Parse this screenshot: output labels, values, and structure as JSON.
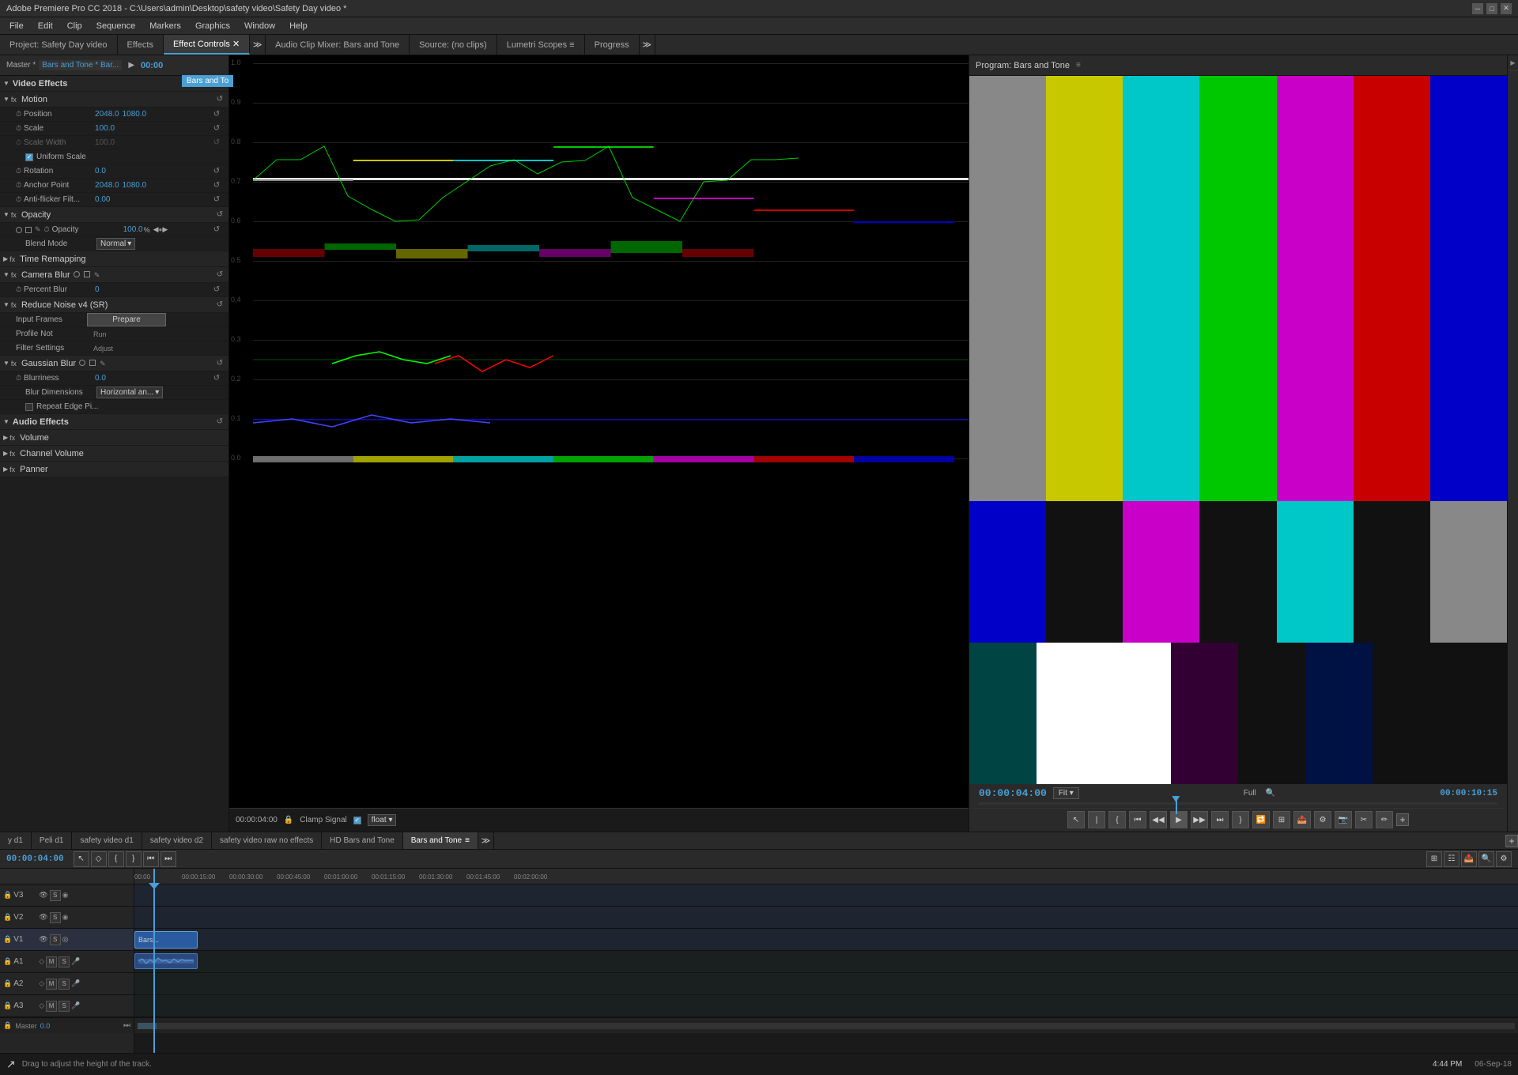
{
  "window": {
    "title": "Adobe Premiere Pro CC 2018 - C:\\Users\\admin\\Desktop\\safety video\\Safety Day video *"
  },
  "menu": {
    "items": [
      "File",
      "Edit",
      "Clip",
      "Sequence",
      "Markers",
      "Graphics",
      "Window",
      "Help"
    ]
  },
  "tabs": {
    "items": [
      {
        "label": "Project: Safety Day video",
        "active": false
      },
      {
        "label": "Effects",
        "active": false
      },
      {
        "label": "Effect Controls",
        "active": true
      },
      {
        "label": "Audio Clip Mixer: Bars and Tone",
        "active": false
      },
      {
        "label": "Source: (no clips)",
        "active": false
      },
      {
        "label": "Lumetri Scopes",
        "active": false
      },
      {
        "label": "Progress",
        "active": false
      }
    ]
  },
  "effect_controls": {
    "master_label": "Master * Bars and Tone *",
    "clip_name": "Bars and Tone * Bar...",
    "time": "00:00",
    "tooltip": "Bars and To",
    "video_effects_label": "Video Effects",
    "motion": {
      "label": "Motion",
      "position_label": "Position",
      "position_x": "2048.0",
      "position_y": "1080.0",
      "scale_label": "Scale",
      "scale_value": "100.0",
      "scale_width_label": "Scale Width",
      "scale_width_value": "100.0",
      "rotation_label": "Rotation",
      "rotation_value": "0.0",
      "anchor_point_label": "Anchor Point",
      "anchor_x": "2048.0",
      "anchor_y": "1080.0",
      "anti_flicker_label": "Anti-flicker Filt...",
      "anti_flicker_value": "0.00",
      "uniform_scale_label": "Uniform Scale"
    },
    "opacity": {
      "label": "Opacity",
      "opacity_label": "Opacity",
      "opacity_value": "100.0",
      "opacity_unit": "%",
      "blend_mode_label": "Blend Mode",
      "blend_mode_value": "Normal"
    },
    "time_remapping": {
      "label": "Time Remapping"
    },
    "camera_blur": {
      "label": "Camera Blur",
      "percent_blur_label": "Percent Blur",
      "percent_blur_value": "0"
    },
    "reduce_noise": {
      "label": "Reduce Noise v4 (SR)",
      "input_frames_label": "Input Frames",
      "prepare_btn": "Prepare",
      "profile_not_label": "Profile Not",
      "profile_run_label": "Run",
      "filter_settings_label": "Filter Settings",
      "adjust_label": "Adjust"
    },
    "gaussian_blur": {
      "label": "Gaussian Blur",
      "blurriness_label": "Blurriness",
      "blurriness_value": "0.0",
      "blur_dimensions_label": "Blur Dimensions",
      "blur_dimensions_value": "Horizontal an...",
      "repeat_edge_label": "Repeat Edge Pi..."
    },
    "audio_effects_label": "Audio Effects",
    "volume": {
      "label": "Volume"
    },
    "channel_volume": {
      "label": "Channel Volume"
    },
    "panner": {
      "label": "Panner"
    }
  },
  "scope": {
    "labels": [
      "1.0",
      "0.9",
      "0.8",
      "0.7",
      "0.6",
      "0.5",
      "0.4",
      "0.3",
      "0.2",
      "0.1",
      "0.0"
    ],
    "y_positions": [
      0,
      50,
      100,
      150,
      200,
      250,
      300,
      350,
      400,
      450,
      500
    ],
    "clamp_signal_label": "Clamp Signal",
    "float_label": "float",
    "time": "00:00:04:00"
  },
  "program_monitor": {
    "title": "Program: Bars and Tone",
    "timecode": "00:00:04:00",
    "fit_label": "Fit",
    "full_label": "Full",
    "duration": "00:00:10:15",
    "color_bars": {
      "top_colors": [
        "#888888",
        "#c8c800",
        "#00c8c8",
        "#00c800",
        "#c800c8",
        "#c80000",
        "#0000c8"
      ],
      "bottom_row1": [
        "#0000c8",
        "#111111",
        "#c800c8",
        "#111111",
        "#00c8c8",
        "#111111",
        "#888888"
      ],
      "bottom_row2": [
        "#004444",
        "#ffffff",
        "#330033",
        "#111111",
        "#001144",
        "#111111",
        "#111111"
      ]
    },
    "transport": {
      "buttons": [
        "⏮",
        "⏴",
        "⏵",
        "⏸",
        "⏭",
        "⏏"
      ]
    }
  },
  "timeline": {
    "tabs": [
      {
        "label": "y d1",
        "active": false
      },
      {
        "label": "Peli d1",
        "active": false
      },
      {
        "label": "safety video d1",
        "active": false
      },
      {
        "label": "safety video d2",
        "active": false
      },
      {
        "label": "safety video raw no effects",
        "active": false
      },
      {
        "label": "HD Bars and Tone",
        "active": false
      },
      {
        "label": "Bars and Tone",
        "active": true
      }
    ],
    "timecode": "00:00:04:00",
    "ruler_marks": [
      "00:00",
      "00:00:15:00",
      "00:00:30:00",
      "00:00:45:00",
      "00:01:00:00",
      "00:01:15:00",
      "00:01:30:00",
      "00:01:45:00",
      "00:02:00:00"
    ],
    "tracks": [
      {
        "name": "V3",
        "type": "video"
      },
      {
        "name": "V2",
        "type": "video"
      },
      {
        "name": "V1",
        "type": "video",
        "has_clip": true,
        "clip_label": "Bars..."
      },
      {
        "name": "A1",
        "type": "audio",
        "has_clip": true
      },
      {
        "name": "A2",
        "type": "audio"
      },
      {
        "name": "A3",
        "type": "audio"
      }
    ],
    "master_label": "Master",
    "master_value": "0.0",
    "playhead_pos": "00:00:04:00"
  },
  "status_bar": {
    "message": "Drag to adjust the height of the track.",
    "time": "4:44 PM",
    "date": "06-Sep-18"
  },
  "colors": {
    "accent": "#4a9fd4",
    "background": "#1a1a1a",
    "panel": "#252525",
    "border": "#111111"
  }
}
